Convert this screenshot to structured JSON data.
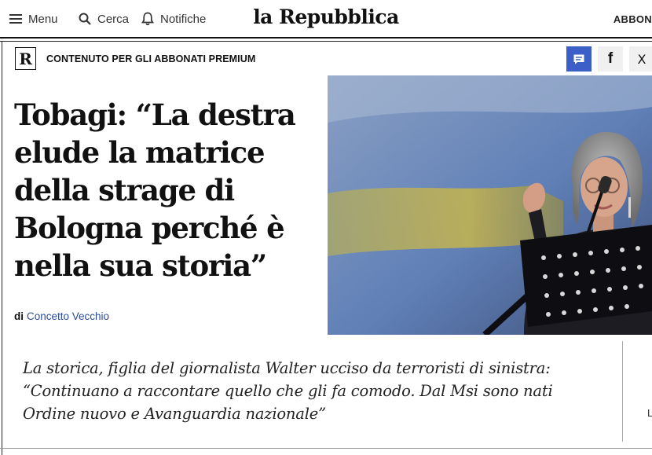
{
  "header": {
    "menu_label": "Menu",
    "search_label": "Cerca",
    "notifications_label": "Notifiche",
    "brand": "la Repubblica",
    "subscribe_label": "ABBON"
  },
  "premium": {
    "logo_letter": "R",
    "label": "CONTENUTO PER GLI ABBONATI PREMIUM"
  },
  "share": {
    "facebook_glyph": "f",
    "x_glyph": "X"
  },
  "article": {
    "headline": "Tobagi: “La destra elude la matrice della strage di Bologna perché è nella sua storia”",
    "byline_prefix": "di",
    "author": "Concetto Vecchio",
    "summary": "La storica, figlia del giornalista Walter ucciso da terroristi di sinistra: “Continuano a raccontare quello che gli fa comodo. Dal Msi sono nati Ordine nuovo e Avanguardia nazionale”",
    "cut_char": "L"
  },
  "colors": {
    "accent_blue": "#3b5fc6",
    "author_link": "#2b4c9b",
    "text": "#111111"
  }
}
